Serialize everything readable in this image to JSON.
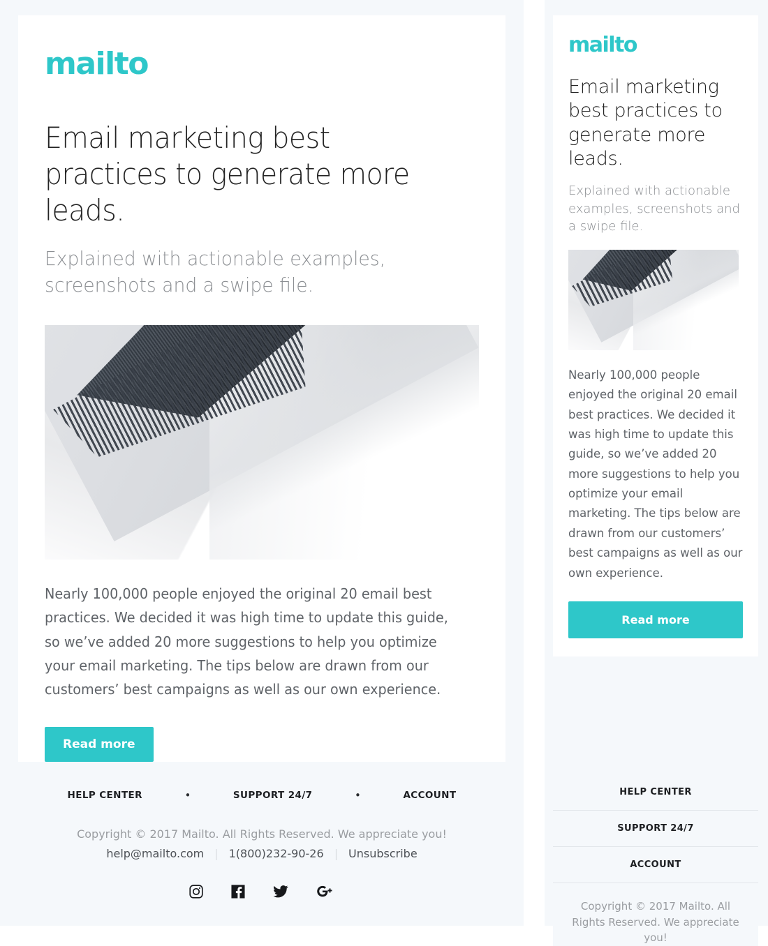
{
  "brand": {
    "name": "mailto",
    "accent_color": "#2ec7c9",
    "page_background": "#f5f8fb",
    "card_background": "#ffffff"
  },
  "desktop": {
    "logo": "mailto",
    "headline": "Email marketing best practices to generate more leads.",
    "subhead": "Explained with actionable examples, screenshots and a swipe file.",
    "hero_image_alt": "dark grey fringed scarf draped over a laptop corner on white bedding",
    "body": "Nearly 100,000 people enjoyed the original 20 email best practices. We decided it was high time to update this guide, so we’ve added 20 more suggestions to help you optimize your email marketing. The tips below are drawn from our customers’ best campaigns as well as our own experience.",
    "cta_label": "Read more",
    "footer": {
      "nav": [
        "HELP CENTER",
        "SUPPORT 24/7",
        "ACCOUNT"
      ],
      "separator": "•",
      "copyright": "Copyright © 2017 Mailto. All Rights Reserved. We appreciate you!",
      "email": "help@mailto.com",
      "phone": "1(800)232-90-26",
      "unsubscribe": "Unsubscribe",
      "link_separator": "|",
      "social": [
        {
          "name": "instagram-icon",
          "label": "Instagram"
        },
        {
          "name": "facebook-icon",
          "label": "Facebook"
        },
        {
          "name": "twitter-icon",
          "label": "Twitter"
        },
        {
          "name": "google-plus-icon",
          "label": "Google Plus"
        }
      ]
    }
  },
  "mobile": {
    "logo": "mailto",
    "headline": "Email marketing best practices to generate more leads.",
    "subhead": "Explained with actionable examples, screenshots and a swipe file.",
    "hero_image_alt": "dark grey fringed scarf draped over a laptop corner on white bedding",
    "body": "Nearly 100,000 people enjoyed the original 20 email best practices. We decided it was high time to update this guide, so we’ve added 20 more suggestions to help you optimize your email marketing. The tips below are drawn from our customers’ best campaigns as well as our own experience.",
    "cta_label": "Read more",
    "footer": {
      "nav": [
        "HELP CENTER",
        "SUPPORT 24/7",
        "ACCOUNT"
      ],
      "copyright": "Copyright © 2017 Mailto. All Rights Reserved. We appreciate you!"
    }
  }
}
